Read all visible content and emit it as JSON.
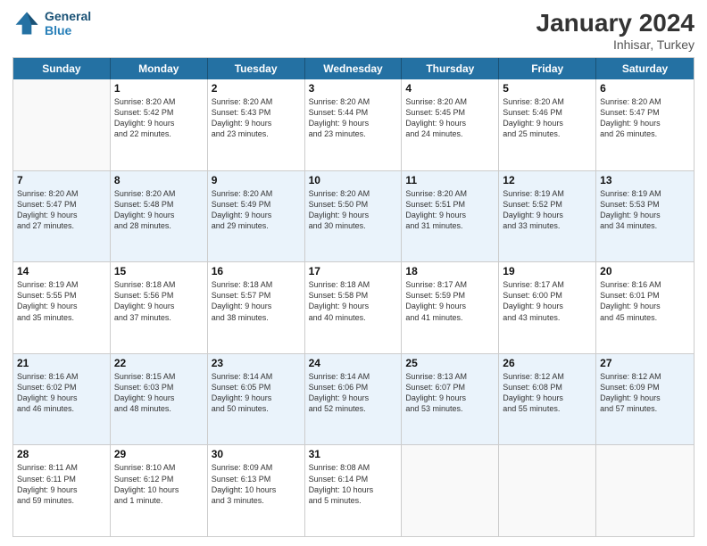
{
  "header": {
    "logo_line1": "General",
    "logo_line2": "Blue",
    "main_title": "January 2024",
    "subtitle": "Inhisar, Turkey"
  },
  "weekdays": [
    "Sunday",
    "Monday",
    "Tuesday",
    "Wednesday",
    "Thursday",
    "Friday",
    "Saturday"
  ],
  "rows": [
    {
      "alt": false,
      "cells": [
        {
          "day": "",
          "info": ""
        },
        {
          "day": "1",
          "info": "Sunrise: 8:20 AM\nSunset: 5:42 PM\nDaylight: 9 hours\nand 22 minutes."
        },
        {
          "day": "2",
          "info": "Sunrise: 8:20 AM\nSunset: 5:43 PM\nDaylight: 9 hours\nand 23 minutes."
        },
        {
          "day": "3",
          "info": "Sunrise: 8:20 AM\nSunset: 5:44 PM\nDaylight: 9 hours\nand 23 minutes."
        },
        {
          "day": "4",
          "info": "Sunrise: 8:20 AM\nSunset: 5:45 PM\nDaylight: 9 hours\nand 24 minutes."
        },
        {
          "day": "5",
          "info": "Sunrise: 8:20 AM\nSunset: 5:46 PM\nDaylight: 9 hours\nand 25 minutes."
        },
        {
          "day": "6",
          "info": "Sunrise: 8:20 AM\nSunset: 5:47 PM\nDaylight: 9 hours\nand 26 minutes."
        }
      ]
    },
    {
      "alt": true,
      "cells": [
        {
          "day": "7",
          "info": "Sunrise: 8:20 AM\nSunset: 5:47 PM\nDaylight: 9 hours\nand 27 minutes."
        },
        {
          "day": "8",
          "info": "Sunrise: 8:20 AM\nSunset: 5:48 PM\nDaylight: 9 hours\nand 28 minutes."
        },
        {
          "day": "9",
          "info": "Sunrise: 8:20 AM\nSunset: 5:49 PM\nDaylight: 9 hours\nand 29 minutes."
        },
        {
          "day": "10",
          "info": "Sunrise: 8:20 AM\nSunset: 5:50 PM\nDaylight: 9 hours\nand 30 minutes."
        },
        {
          "day": "11",
          "info": "Sunrise: 8:20 AM\nSunset: 5:51 PM\nDaylight: 9 hours\nand 31 minutes."
        },
        {
          "day": "12",
          "info": "Sunrise: 8:19 AM\nSunset: 5:52 PM\nDaylight: 9 hours\nand 33 minutes."
        },
        {
          "day": "13",
          "info": "Sunrise: 8:19 AM\nSunset: 5:53 PM\nDaylight: 9 hours\nand 34 minutes."
        }
      ]
    },
    {
      "alt": false,
      "cells": [
        {
          "day": "14",
          "info": "Sunrise: 8:19 AM\nSunset: 5:55 PM\nDaylight: 9 hours\nand 35 minutes."
        },
        {
          "day": "15",
          "info": "Sunrise: 8:18 AM\nSunset: 5:56 PM\nDaylight: 9 hours\nand 37 minutes."
        },
        {
          "day": "16",
          "info": "Sunrise: 8:18 AM\nSunset: 5:57 PM\nDaylight: 9 hours\nand 38 minutes."
        },
        {
          "day": "17",
          "info": "Sunrise: 8:18 AM\nSunset: 5:58 PM\nDaylight: 9 hours\nand 40 minutes."
        },
        {
          "day": "18",
          "info": "Sunrise: 8:17 AM\nSunset: 5:59 PM\nDaylight: 9 hours\nand 41 minutes."
        },
        {
          "day": "19",
          "info": "Sunrise: 8:17 AM\nSunset: 6:00 PM\nDaylight: 9 hours\nand 43 minutes."
        },
        {
          "day": "20",
          "info": "Sunrise: 8:16 AM\nSunset: 6:01 PM\nDaylight: 9 hours\nand 45 minutes."
        }
      ]
    },
    {
      "alt": true,
      "cells": [
        {
          "day": "21",
          "info": "Sunrise: 8:16 AM\nSunset: 6:02 PM\nDaylight: 9 hours\nand 46 minutes."
        },
        {
          "day": "22",
          "info": "Sunrise: 8:15 AM\nSunset: 6:03 PM\nDaylight: 9 hours\nand 48 minutes."
        },
        {
          "day": "23",
          "info": "Sunrise: 8:14 AM\nSunset: 6:05 PM\nDaylight: 9 hours\nand 50 minutes."
        },
        {
          "day": "24",
          "info": "Sunrise: 8:14 AM\nSunset: 6:06 PM\nDaylight: 9 hours\nand 52 minutes."
        },
        {
          "day": "25",
          "info": "Sunrise: 8:13 AM\nSunset: 6:07 PM\nDaylight: 9 hours\nand 53 minutes."
        },
        {
          "day": "26",
          "info": "Sunrise: 8:12 AM\nSunset: 6:08 PM\nDaylight: 9 hours\nand 55 minutes."
        },
        {
          "day": "27",
          "info": "Sunrise: 8:12 AM\nSunset: 6:09 PM\nDaylight: 9 hours\nand 57 minutes."
        }
      ]
    },
    {
      "alt": false,
      "cells": [
        {
          "day": "28",
          "info": "Sunrise: 8:11 AM\nSunset: 6:11 PM\nDaylight: 9 hours\nand 59 minutes."
        },
        {
          "day": "29",
          "info": "Sunrise: 8:10 AM\nSunset: 6:12 PM\nDaylight: 10 hours\nand 1 minute."
        },
        {
          "day": "30",
          "info": "Sunrise: 8:09 AM\nSunset: 6:13 PM\nDaylight: 10 hours\nand 3 minutes."
        },
        {
          "day": "31",
          "info": "Sunrise: 8:08 AM\nSunset: 6:14 PM\nDaylight: 10 hours\nand 5 minutes."
        },
        {
          "day": "",
          "info": ""
        },
        {
          "day": "",
          "info": ""
        },
        {
          "day": "",
          "info": ""
        }
      ]
    }
  ]
}
